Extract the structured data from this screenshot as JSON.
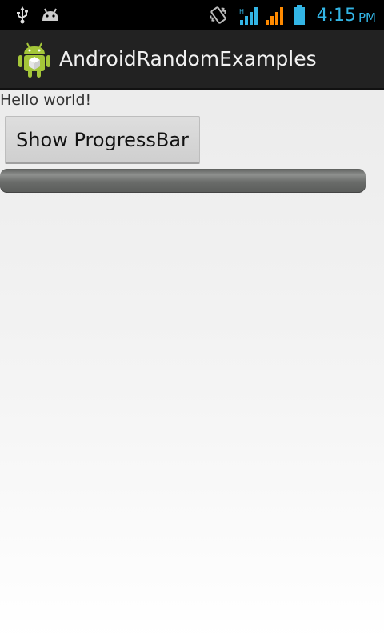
{
  "status_bar": {
    "time": "4:15",
    "ampm": "PM",
    "icons": [
      "usb-icon",
      "android-debug-icon",
      "vibrate-icon",
      "signal-1-icon",
      "signal-2-icon",
      "battery-icon"
    ],
    "accent_color": "#33b5e5",
    "orange_color": "#ff8a00"
  },
  "action_bar": {
    "title": "AndroidRandomExamples",
    "icon": "android-app-icon"
  },
  "content": {
    "hello_text": "Hello world!",
    "button_label": "Show ProgressBar",
    "progress": 0
  }
}
